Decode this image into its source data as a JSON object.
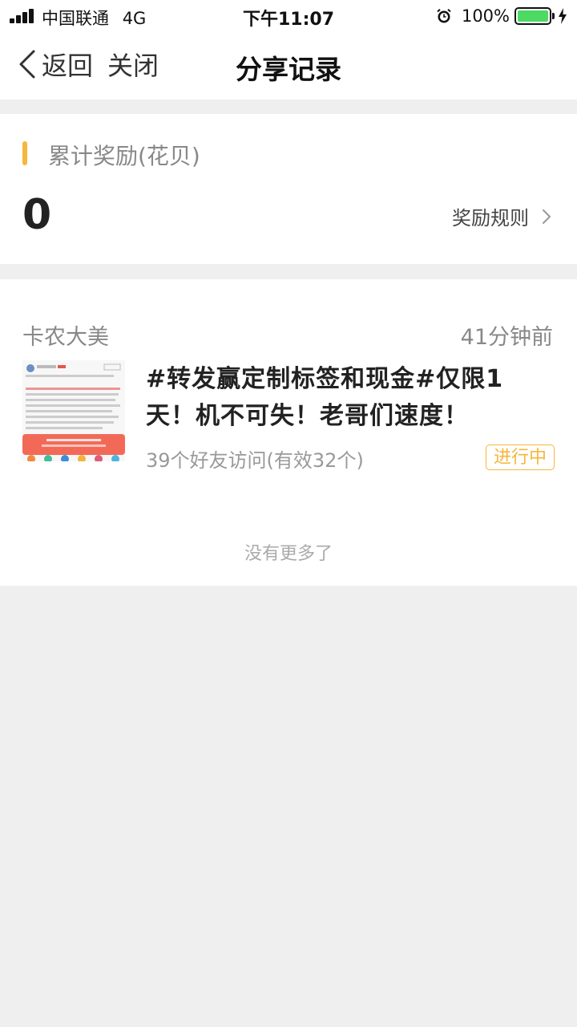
{
  "status_bar": {
    "carrier": "中国联通",
    "network": "4G",
    "time": "下午11:07",
    "battery_percent": "100%"
  },
  "nav": {
    "back_label": "返回",
    "close_label": "关闭",
    "title": "分享记录"
  },
  "reward": {
    "label": "累计奖励(花贝)",
    "value": "0",
    "rules_label": "奖励规则"
  },
  "records": [
    {
      "user": "卡农大美",
      "time": "41分钟前",
      "title": "#转发赢定制标签和现金#仅限1天！机不可失！老哥们速度！",
      "visits": "39个好友访问(有效32个)",
      "status": "进行中"
    }
  ],
  "footer": {
    "no_more": "没有更多了"
  },
  "colors": {
    "accent": "#f6b73c",
    "background": "#efefef",
    "battery": "#4cd964"
  }
}
